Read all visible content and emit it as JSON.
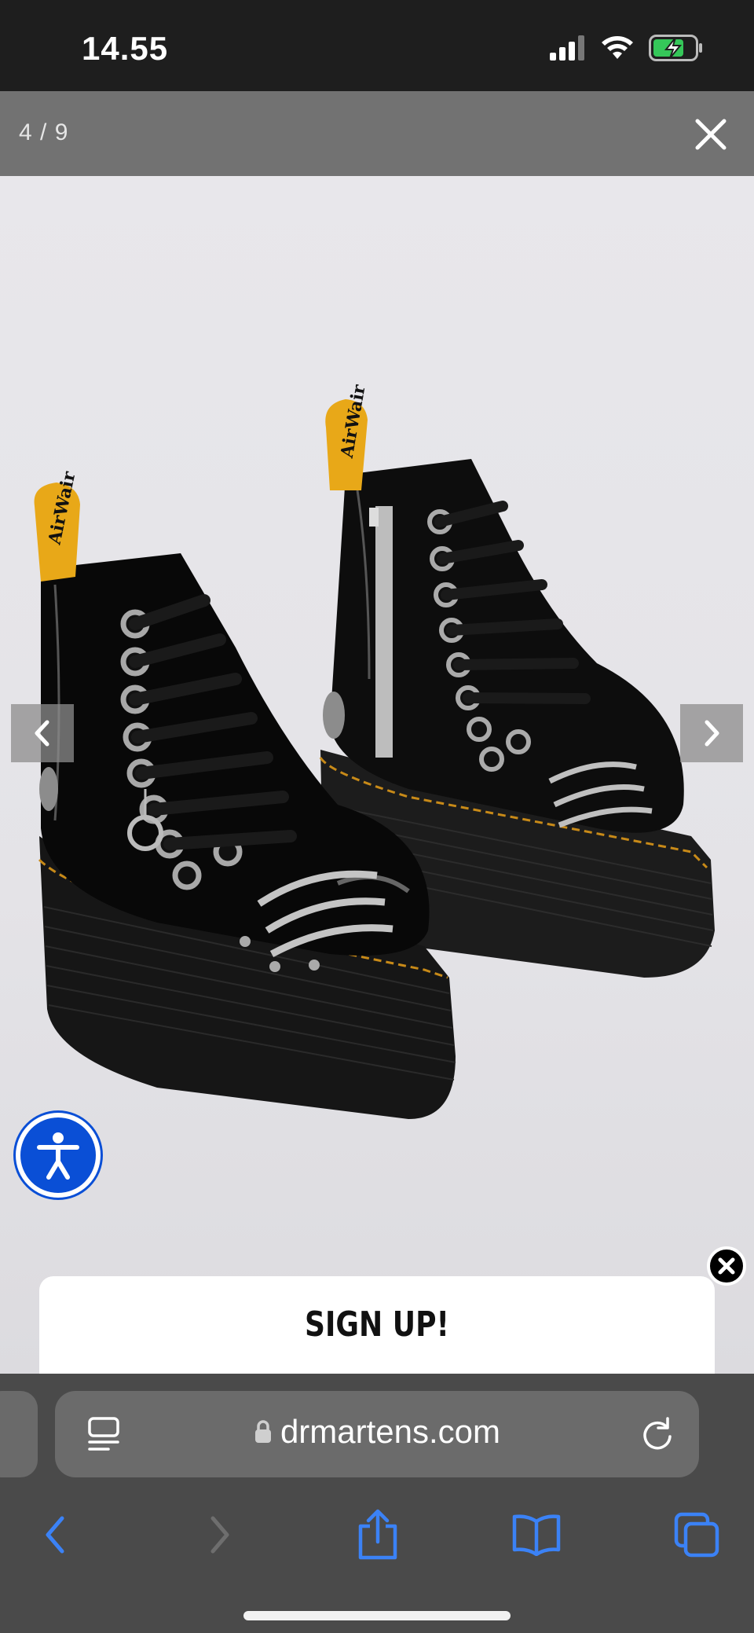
{
  "status_bar": {
    "time": "14.55",
    "icons": [
      "cellular-signal-icon",
      "wifi-icon",
      "battery-charging-icon"
    ]
  },
  "gallery": {
    "counter": "4 / 9",
    "close_icon": "close-icon",
    "prev_icon": "chevron-left-icon",
    "next_icon": "chevron-right-icon",
    "image_current_index": 4,
    "image_total": 9
  },
  "accessibility": {
    "icon": "accessibility-person-icon",
    "color": "#0a4fd6"
  },
  "signup_popup": {
    "title": "SIGN UP!",
    "close_icon": "close-icon"
  },
  "browser": {
    "url": "drmartens.com",
    "lock_icon": "lock-icon",
    "reader_icon": "reader-mode-icon",
    "reload_icon": "reload-icon",
    "toolbar": [
      "back-icon",
      "forward-icon",
      "share-icon",
      "bookmarks-icon",
      "tabs-icon"
    ],
    "accent": "#3b82f6"
  }
}
